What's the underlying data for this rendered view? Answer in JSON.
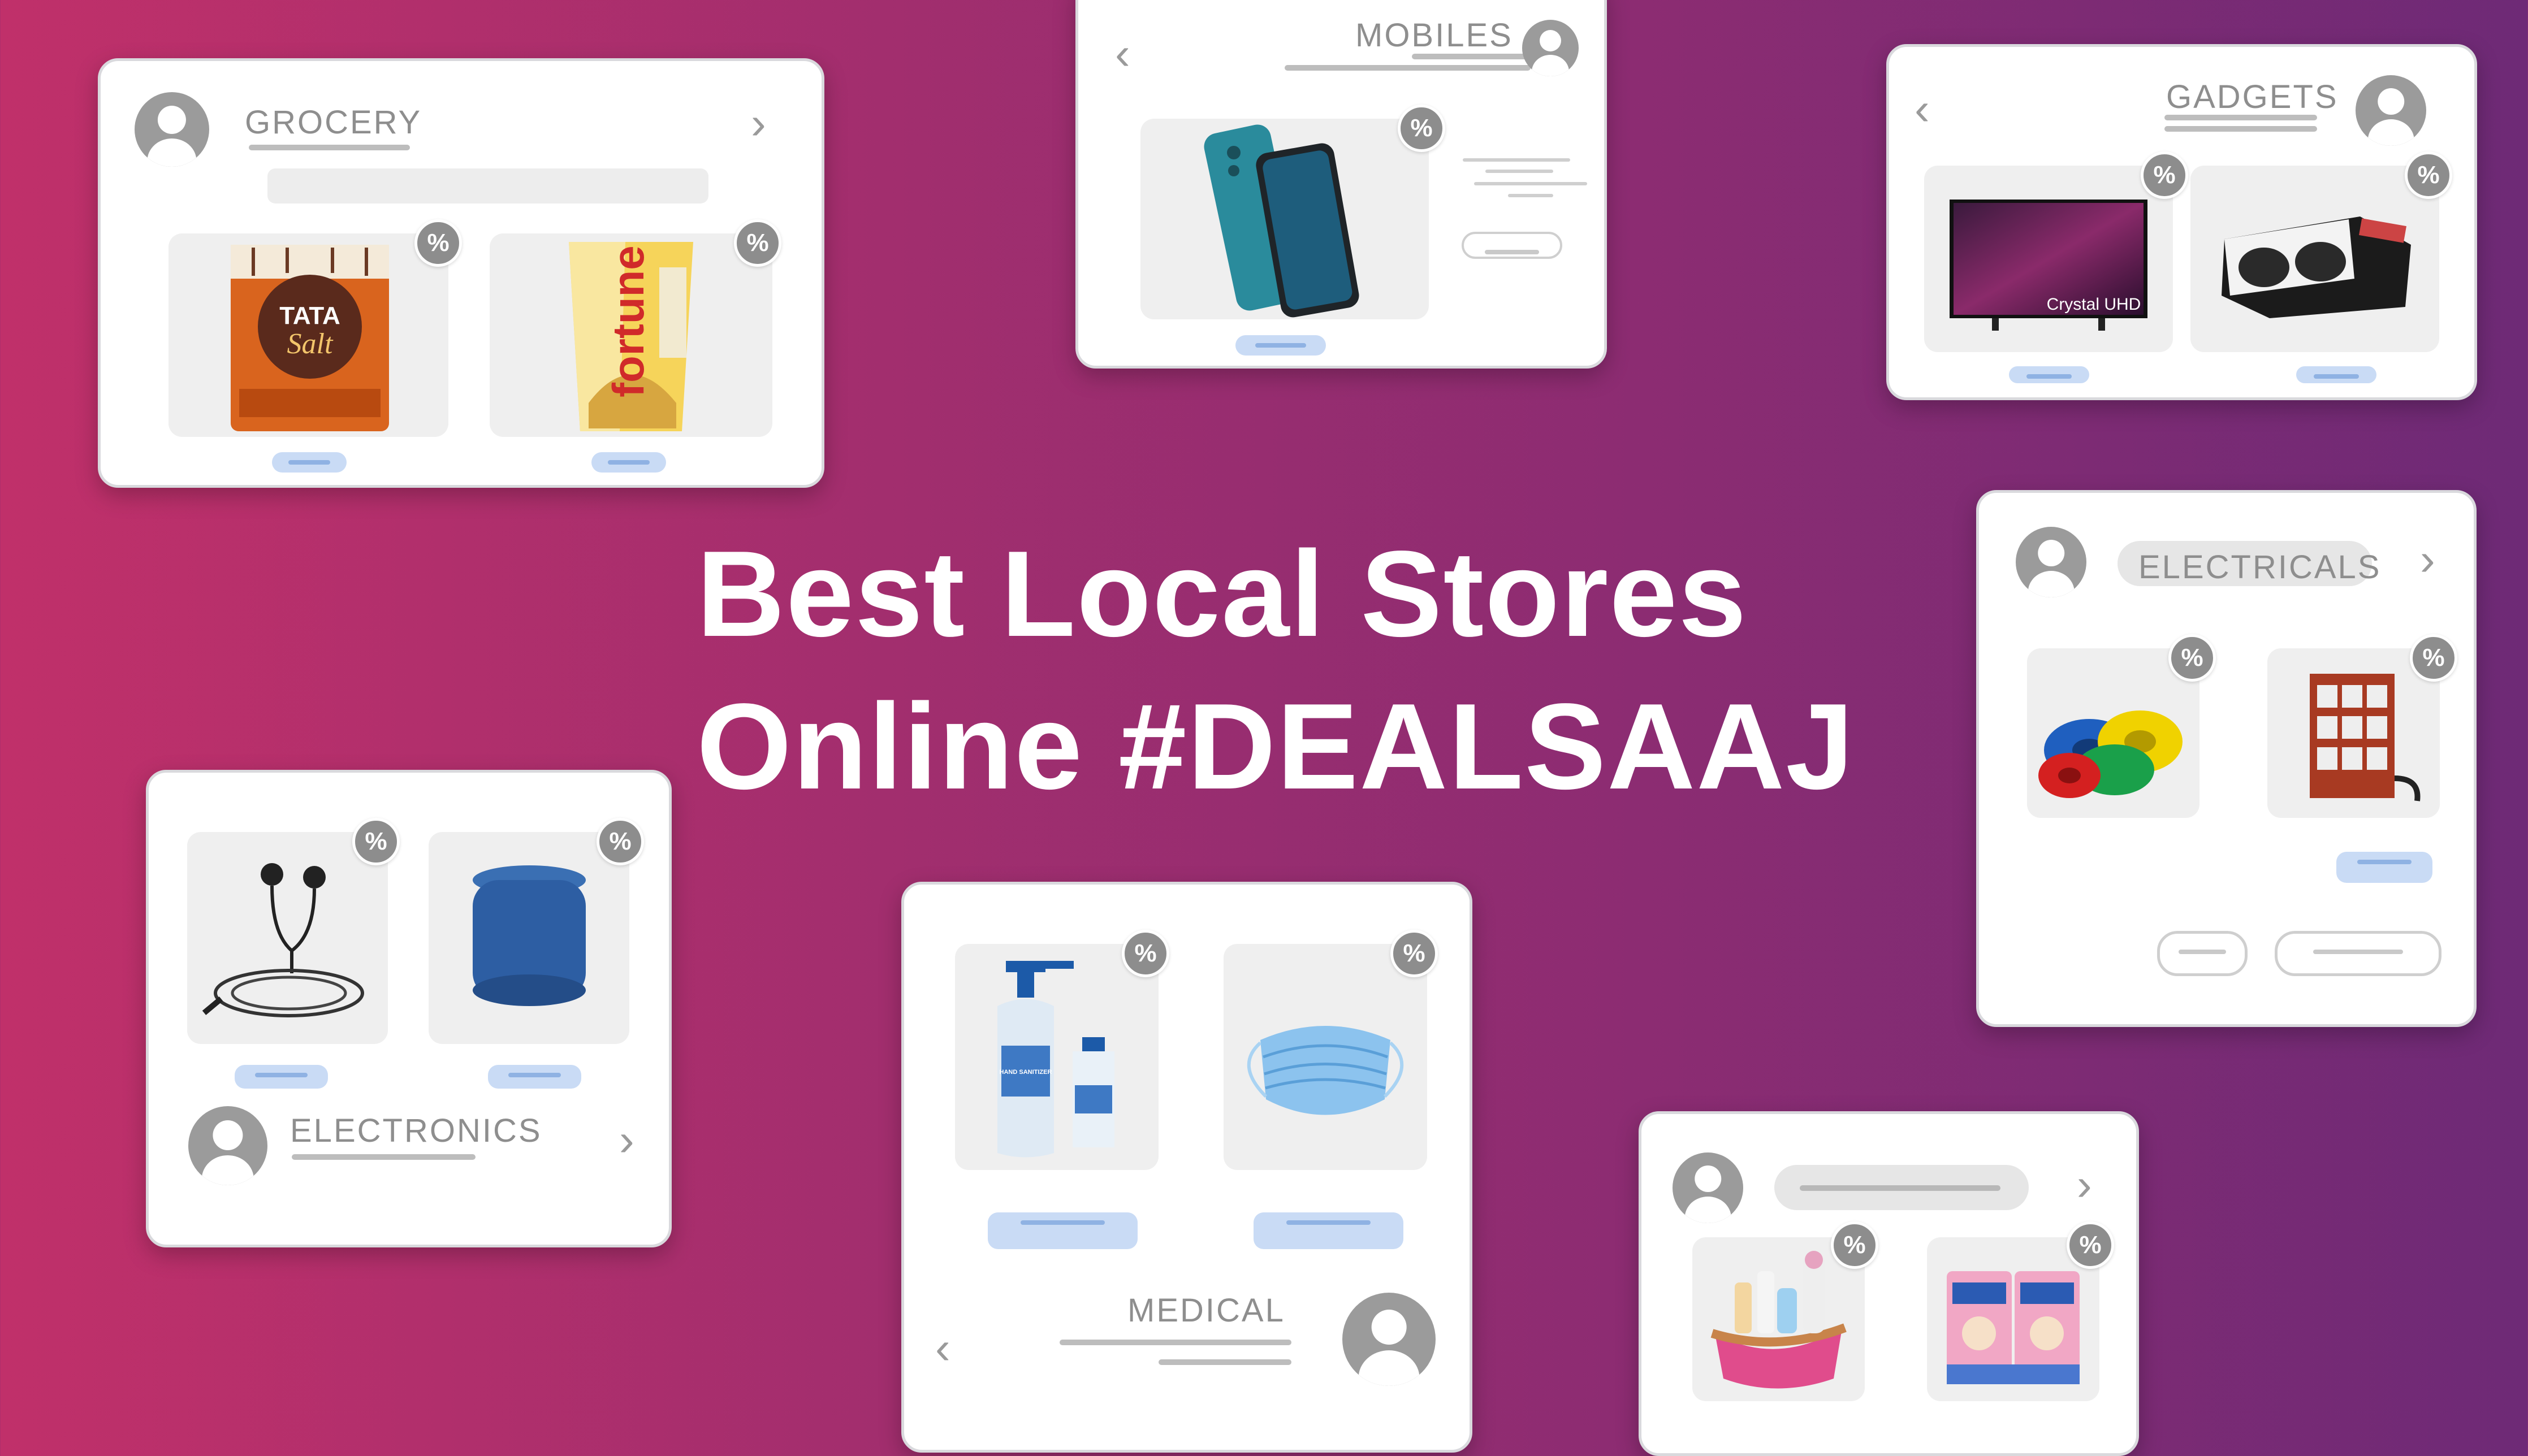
{
  "headline": {
    "line1": "Best Local Stores",
    "line2": "Online #DEALSAAJ"
  },
  "badge_symbol": "%",
  "cards": {
    "grocery": {
      "title": "GROCERY",
      "chevron": "›"
    },
    "mobiles": {
      "title": "MOBILES",
      "chevron": "‹"
    },
    "gadgets": {
      "title": "GADGETS",
      "chevron": "‹",
      "tv_label": "Crystal UHD"
    },
    "electricals": {
      "title": "ELECTRICALS",
      "chevron": "›"
    },
    "electronics": {
      "title": "ELECTRONICS",
      "chevron": "›"
    },
    "medical": {
      "title": "MEDICAL",
      "chevron": "‹",
      "sanitizer_label": "HAND SANITIZER"
    },
    "baby": {
      "chevron": "›"
    }
  },
  "products": {
    "tata_salt": {
      "brand": "TATA",
      "name": "Salt"
    },
    "fortune_oil": {
      "brand": "fortune"
    }
  },
  "colors": {
    "background_start": "#c0306a",
    "background_end": "#6e2a76",
    "card": "#ffffff",
    "badge": "#8d8d8d",
    "pill": "#c9dbf5"
  },
  "icons": [
    "avatar-icon",
    "chevron-right-icon",
    "chevron-left-icon",
    "percent-badge-icon"
  ]
}
